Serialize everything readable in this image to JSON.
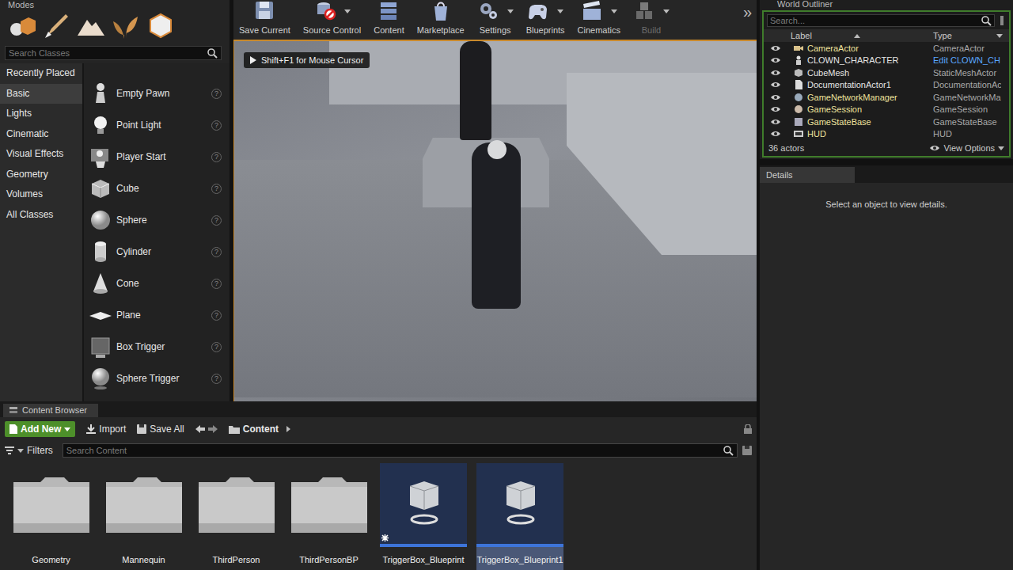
{
  "modes": {
    "title": "Modes",
    "search": {
      "placeholder": "Search Classes"
    },
    "categories": [
      {
        "label": "Recently Placed",
        "selected": false
      },
      {
        "label": "Basic",
        "selected": true
      },
      {
        "label": "Lights",
        "selected": false
      },
      {
        "label": "Cinematic",
        "selected": false
      },
      {
        "label": "Visual Effects",
        "selected": false
      },
      {
        "label": "Geometry",
        "selected": false
      },
      {
        "label": "Volumes",
        "selected": false
      },
      {
        "label": "All Classes",
        "selected": false
      }
    ],
    "items": [
      {
        "label": "Empty Pawn",
        "help": "?"
      },
      {
        "label": "Point Light",
        "help": "?"
      },
      {
        "label": "Player Start",
        "help": "?"
      },
      {
        "label": "Cube",
        "help": "?"
      },
      {
        "label": "Sphere",
        "help": "?"
      },
      {
        "label": "Cylinder",
        "help": "?"
      },
      {
        "label": "Cone",
        "help": "?"
      },
      {
        "label": "Plane",
        "help": "?"
      },
      {
        "label": "Box Trigger",
        "help": "?"
      },
      {
        "label": "Sphere Trigger",
        "help": "?"
      }
    ]
  },
  "toolbar": {
    "buttons": [
      {
        "label": "Save Current",
        "dropdown": false,
        "disabled": false
      },
      {
        "label": "Source Control",
        "dropdown": true,
        "disabled": false
      },
      {
        "label": "Content",
        "dropdown": false,
        "disabled": false
      },
      {
        "label": "Marketplace",
        "dropdown": false,
        "disabled": false
      },
      {
        "label": "Settings",
        "dropdown": true,
        "disabled": false
      },
      {
        "label": "Blueprints",
        "dropdown": true,
        "disabled": false
      },
      {
        "label": "Cinematics",
        "dropdown": true,
        "disabled": false
      },
      {
        "label": "Build",
        "dropdown": true,
        "disabled": true
      }
    ],
    "overflow": "»"
  },
  "viewport": {
    "hint": "Shift+F1 for Mouse Cursor"
  },
  "content_browser": {
    "title": "Content Browser",
    "add_new": "Add New",
    "import": "Import",
    "save_all": "Save All",
    "path": [
      "Content"
    ],
    "filters": "Filters",
    "search": {
      "placeholder": "Search Content"
    },
    "assets": [
      {
        "name": "Geometry",
        "kind": "folder",
        "selected": false,
        "unsaved": false
      },
      {
        "name": "Mannequin",
        "kind": "folder",
        "selected": false,
        "unsaved": false
      },
      {
        "name": "ThirdPerson",
        "kind": "folder",
        "selected": false,
        "unsaved": false
      },
      {
        "name": "ThirdPersonBP",
        "kind": "folder",
        "selected": false,
        "unsaved": false
      },
      {
        "name": "TriggerBox_Blueprint",
        "kind": "blueprint",
        "selected": false,
        "unsaved": true
      },
      {
        "name": "TriggerBox_Blueprint1",
        "kind": "blueprint",
        "selected": true,
        "unsaved": false
      }
    ]
  },
  "world_outliner": {
    "title": "World Outliner",
    "search": {
      "placeholder": "Search..."
    },
    "columns": [
      "Label",
      "Type"
    ],
    "rows": [
      {
        "label": "CameraActor",
        "type": "CameraActor",
        "link": false,
        "spawned": true
      },
      {
        "label": "CLOWN_CHARACTER",
        "type": "Edit CLOWN_CH",
        "link": true,
        "spawned": false
      },
      {
        "label": "CubeMesh",
        "type": "StaticMeshActor",
        "link": false,
        "spawned": false
      },
      {
        "label": "DocumentationActor1",
        "type": "DocumentationAc",
        "link": false,
        "spawned": false
      },
      {
        "label": "GameNetworkManager",
        "type": "GameNetworkMa",
        "link": false,
        "spawned": true
      },
      {
        "label": "GameSession",
        "type": "GameSession",
        "link": false,
        "spawned": true
      },
      {
        "label": "GameStateBase",
        "type": "GameStateBase",
        "link": false,
        "spawned": true
      },
      {
        "label": "HUD",
        "type": "HUD",
        "link": false,
        "spawned": true
      }
    ],
    "count": "36 actors",
    "view_options": "View Options"
  },
  "details": {
    "title": "Details",
    "message": "Select an object to view details."
  }
}
